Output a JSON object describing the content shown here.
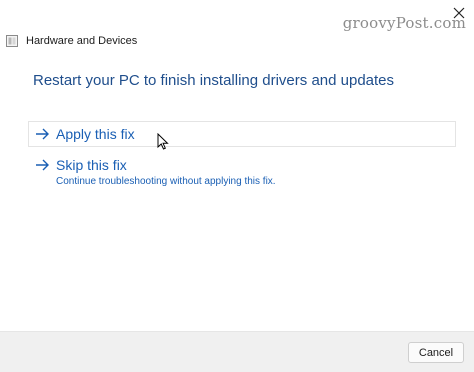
{
  "window": {
    "title": "Hardware and Devices",
    "close_icon": "close-icon",
    "app_icon": "troubleshooter-icon"
  },
  "watermark": "groovyPost.com",
  "main": {
    "heading": "Restart your PC to finish installing drivers and updates",
    "options": [
      {
        "label": "Apply this fix",
        "description": "",
        "icon": "arrow-right-icon"
      },
      {
        "label": "Skip this fix",
        "description": "Continue troubleshooting without applying this fix.",
        "icon": "arrow-right-icon"
      }
    ]
  },
  "footer": {
    "cancel_label": "Cancel"
  },
  "colors": {
    "heading": "#1f4e8c",
    "link": "#1a5fb4",
    "footer_bg": "#f0f0f0"
  }
}
